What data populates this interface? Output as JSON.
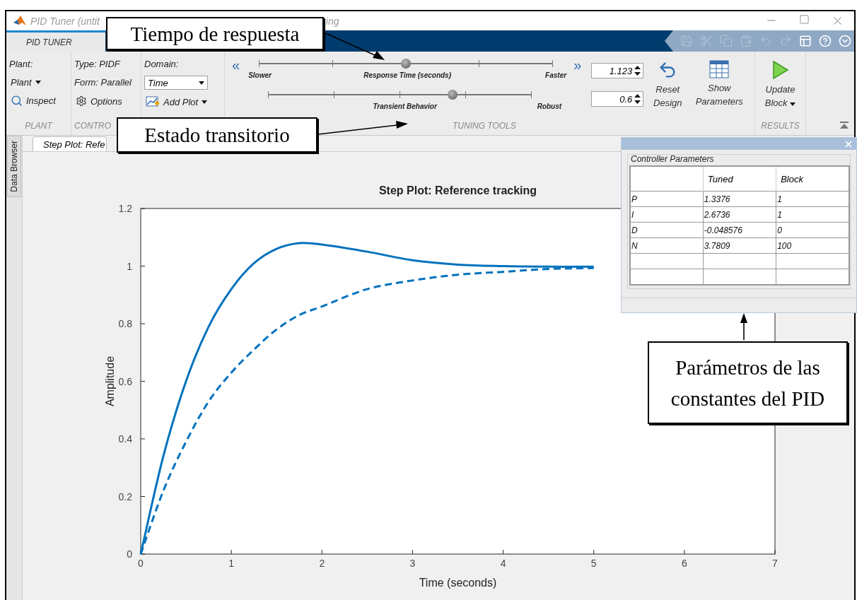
{
  "window": {
    "title_parts": [
      "PID Tuner (untit",
      "ing"
    ]
  },
  "tabs": [
    {
      "label": "PID TUNER",
      "selected": true
    }
  ],
  "quick_access": [
    {
      "kind": "save",
      "disabled": true
    },
    {
      "kind": "cut",
      "disabled": true
    },
    {
      "kind": "copy",
      "disabled": true
    },
    {
      "kind": "paste",
      "disabled": true
    },
    {
      "kind": "undo",
      "disabled": true
    },
    {
      "kind": "redo",
      "disabled": true
    },
    {
      "kind": "window",
      "disabled": false
    },
    {
      "kind": "help",
      "disabled": false
    },
    {
      "kind": "more",
      "disabled": false
    }
  ],
  "ribbon": {
    "plant": {
      "heading": "Plant:",
      "plant_menu": "Plant",
      "inspect": "Inspect",
      "section": "PLANT"
    },
    "controller": {
      "type": "Type: PIDF",
      "form": "Form: Parallel",
      "options": "Options",
      "section": "CONTRO"
    },
    "domain": {
      "heading": "Domain:",
      "value": "Time",
      "add_plot": "Add Plot"
    },
    "tuning": {
      "left_arrow": "«",
      "right_arrow": "»",
      "sliders": [
        {
          "left": "Slower",
          "center": "Response Time (seconds)",
          "right": "Faster",
          "level": 0.5,
          "value": "1.123"
        },
        {
          "center": "Transient Behavior",
          "right": "Robust",
          "level": 0.7,
          "value": "0.6"
        }
      ],
      "reset": "Reset Design",
      "show_parameters": "Show Parameters",
      "section": "TUNING TOOLS"
    },
    "results": {
      "update": "Update Block",
      "section": "RESULTS"
    }
  },
  "document": {
    "side_tab": "Data Browser",
    "tab": "Step Plot: Refe",
    "chart_data": {
      "type": "line",
      "title": "Step Plot: Reference tracking",
      "xlabel": "Time (seconds)",
      "ylabel": "Amplitude",
      "x": [
        0,
        0.25,
        0.5,
        0.75,
        1,
        1.25,
        1.5,
        1.75,
        2,
        2.5,
        3,
        3.5,
        4,
        4.5,
        5
      ],
      "series": [
        {
          "color": "#0072bd",
          "line_style": "solid",
          "values": [
            0,
            0.34,
            0.6,
            0.79,
            0.92,
            1.01,
            1.06,
            1.08,
            1.075,
            1.05,
            1.02,
            1.005,
            1.0,
            0.998,
            0.998
          ]
        },
        {
          "color": "#0072bd",
          "line_style": "dashed",
          "values": [
            0,
            0.22,
            0.39,
            0.53,
            0.63,
            0.71,
            0.78,
            0.83,
            0.86,
            0.92,
            0.95,
            0.97,
            0.98,
            0.99,
            0.993
          ]
        }
      ],
      "xlim": [
        0,
        7
      ],
      "ylim": [
        0,
        1.2
      ],
      "xticks": [
        0,
        1,
        2,
        3,
        4,
        5,
        6,
        7
      ],
      "yticks": [
        0,
        0.2,
        0.4,
        0.6,
        0.8,
        1,
        1.2
      ]
    }
  },
  "parameters_panel": {
    "title": "Controller Parameters",
    "columns": [
      "",
      "Tuned",
      "Block"
    ],
    "rows": [
      [
        "P",
        "1.3376",
        "1"
      ],
      [
        "I",
        "2.6736",
        "1"
      ],
      [
        "D",
        "-0.048576",
        "0"
      ],
      [
        "N",
        "3.7809",
        "100"
      ]
    ]
  },
  "annotations": [
    {
      "text": "Tiempo de respuesta"
    },
    {
      "text": "Estado transitorio"
    },
    {
      "text": "Parámetros de las constantes del PID"
    }
  ]
}
